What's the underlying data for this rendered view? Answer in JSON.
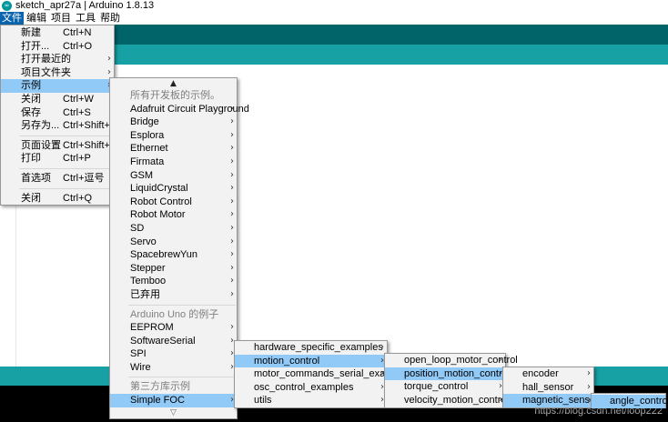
{
  "window": {
    "title": "sketch_apr27a | Arduino 1.8.13",
    "icon": "arduino-logo-icon",
    "icon_glyph": "∞"
  },
  "menubar": {
    "items": [
      "文件",
      "编辑",
      "项目",
      "工具",
      "帮助"
    ]
  },
  "file_menu": {
    "items": [
      {
        "label": "新建",
        "shortcut": "Ctrl+N"
      },
      {
        "label": "打开...",
        "shortcut": "Ctrl+O"
      },
      {
        "label": "打开最近的",
        "shortcut": ""
      },
      {
        "label": "项目文件夹",
        "shortcut": ""
      },
      {
        "label": "示例",
        "shortcut": ""
      },
      {
        "label": "关闭",
        "shortcut": "Ctrl+W"
      },
      {
        "label": "保存",
        "shortcut": "Ctrl+S"
      },
      {
        "label": "另存为...",
        "shortcut": "Ctrl+Shift+S"
      },
      {
        "label": "页面设置",
        "shortcut": "Ctrl+Shift+P"
      },
      {
        "label": "打印",
        "shortcut": "Ctrl+P"
      },
      {
        "label": "首选项",
        "shortcut": "Ctrl+逗号"
      },
      {
        "label": "关闭",
        "shortcut": "Ctrl+Q"
      }
    ]
  },
  "examples_menu": {
    "scroll_up": "▲",
    "scroll_down": "▽",
    "section_all": "所有开发板的示例。",
    "builtin": [
      "Adafruit Circuit Playground",
      "Bridge",
      "Esplora",
      "Ethernet",
      "Firmata",
      "GSM",
      "LiquidCrystal",
      "Robot Control",
      "Robot Motor",
      "SD",
      "Servo",
      "SpacebrewYun",
      "Stepper",
      "Temboo",
      "已弃用"
    ],
    "section_board": "Arduino Uno 的例子",
    "board": [
      "EEPROM",
      "SoftwareSerial",
      "SPI",
      "Wire"
    ],
    "section_third_party": "第三方库示例",
    "third_party": [
      "Simple FOC"
    ]
  },
  "foc_menu": {
    "items": [
      "hardware_specific_examples",
      "motion_control",
      "motor_commands_serial_examples",
      "osc_control_examples",
      "utils"
    ]
  },
  "motion_menu": {
    "items": [
      "open_loop_motor_control",
      "position_motion_control",
      "torque_control",
      "velocity_motion_control"
    ]
  },
  "position_menu": {
    "items": [
      "encoder",
      "hall_sensor",
      "magnetic_sensor"
    ]
  },
  "magnetic_menu": {
    "items": [
      "angle_control"
    ]
  },
  "arrow_glyph": "›",
  "watermark": "https://blog.csdn.net/loop222",
  "colors": {
    "toolbar": "#006468",
    "tabbar": "#17a1a5",
    "highlight": "#91c9f7",
    "menubar_active": "#0a64ad"
  }
}
